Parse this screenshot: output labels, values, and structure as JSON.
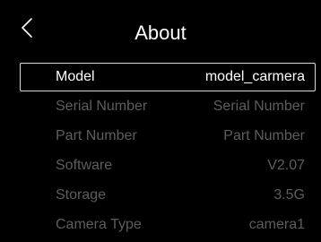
{
  "header": {
    "title": "About"
  },
  "rows": [
    {
      "label": "Model",
      "value": "model_carmera",
      "selected": true
    },
    {
      "label": "Serial Number",
      "value": "Serial Number"
    },
    {
      "label": "Part Number",
      "value": "Part Number"
    },
    {
      "label": "Software",
      "value": "V2.07"
    },
    {
      "label": "Storage",
      "value": "3.5G"
    },
    {
      "label": "Camera Type",
      "value": "camera1"
    }
  ],
  "colors": {
    "background": "#000000",
    "text_selected": "#ffffff",
    "text_dim": "#5d5d5d",
    "selection_border": "#d8d8d8"
  },
  "icons": {
    "back": "chevron-left-icon"
  }
}
